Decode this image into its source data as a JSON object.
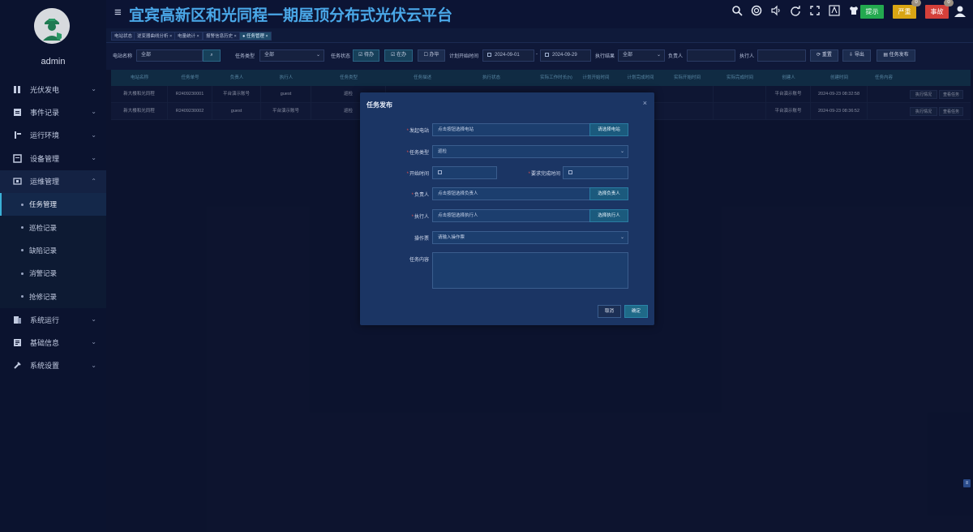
{
  "app": {
    "title": "宜宾高新区和光同程一期屋顶分布式光伏云平台"
  },
  "user": {
    "name": "admin"
  },
  "header": {
    "alarms": [
      {
        "label": "提示",
        "color": "#23a94f",
        "count": ""
      },
      {
        "label": "严重",
        "color": "#d9a514",
        "count": "0"
      },
      {
        "label": "事故",
        "color": "#d4403a",
        "count": "0"
      }
    ]
  },
  "sidebar": {
    "items": [
      {
        "label": "光伏发电",
        "icon": "solar-icon"
      },
      {
        "label": "事件记录",
        "icon": "record-icon"
      },
      {
        "label": "运行环境",
        "icon": "environment-icon"
      },
      {
        "label": "设备管理",
        "icon": "device-icon"
      },
      {
        "label": "运维管理",
        "icon": "maintenance-icon"
      }
    ],
    "subitems": [
      {
        "label": "任务管理"
      },
      {
        "label": "巡检记录"
      },
      {
        "label": "缺陷记录"
      },
      {
        "label": "消警记录"
      },
      {
        "label": "抢修记录"
      }
    ],
    "bottom_items": [
      {
        "label": "系统运行",
        "icon": "system-run-icon"
      },
      {
        "label": "基础信息",
        "icon": "info-icon"
      },
      {
        "label": "系统设置",
        "icon": "settings-icon"
      }
    ]
  },
  "tabs": [
    {
      "label": "电站状态"
    },
    {
      "label": "逆变器曲线分析 ×"
    },
    {
      "label": "电量统计 ×"
    },
    {
      "label": "报警信息历史 ×"
    },
    {
      "label": "● 任务管理 ×"
    }
  ],
  "filters": {
    "station_label": "电站名称",
    "station_value": "全部",
    "type_label": "任务类型",
    "type_value": "全部",
    "status_label": "任务状态",
    "status_opt1": "待办",
    "status_opt2": "在办",
    "status_opt3": "办毕",
    "time_label": "计划开始时间",
    "date_from": "2024-09-01",
    "date_sep": "-",
    "date_to": "2024-09-29",
    "result_label": "执行结果",
    "result_value": "全部",
    "owner_label": "负责人",
    "owner_value": "",
    "executor_label": "执行人",
    "executor_value": "",
    "reset": "重置",
    "export": "导出",
    "publish": "任务发布"
  },
  "table": {
    "headers": [
      "电站名称",
      "任务单号",
      "负责人",
      "执行人",
      "任务类型",
      "任务描述",
      "执行状态",
      "实际工作时长(h)",
      "计划开始时间",
      "计划完成时间",
      "实际开始时间",
      "实际完成时间",
      "创建人",
      "创建时间",
      "任务内容"
    ],
    "rows": [
      {
        "station": "新大楼和光同程",
        "no": "R2409230001",
        "owner": "平台演示账号",
        "executor": "guest",
        "type": "巡检",
        "creator": "平台演示账号",
        "created": "2024-09-23 08:32:58"
      },
      {
        "station": "新大楼和光同程",
        "no": "R2409230002",
        "owner": "guest",
        "executor": "平台演示账号",
        "type": "巡检",
        "creator": "平台演示账号",
        "created": "2024-09-23 08:36:52"
      }
    ],
    "action1": "执行情况",
    "action2": "查看任务"
  },
  "modal": {
    "title": "任务发布",
    "close": "×",
    "station_label": "发起电站",
    "station_placeholder": "点击按钮选择电站",
    "station_btn": "请选择电站",
    "type_label": "任务类型",
    "type_value": "巡检",
    "start_label": "开始时间",
    "deadline_label": "要求完成时间",
    "owner_label": "负责人",
    "owner_placeholder": "点击按钮选择负责人",
    "owner_btn": "选择负责人",
    "executor_label": "执行人",
    "executor_placeholder": "点击按钮选择执行人",
    "executor_btn": "选择执行人",
    "ticket_label": "操作票",
    "ticket_placeholder": "请输入操作票",
    "content_label": "任务内容",
    "cancel": "取消",
    "ok": "确定"
  }
}
